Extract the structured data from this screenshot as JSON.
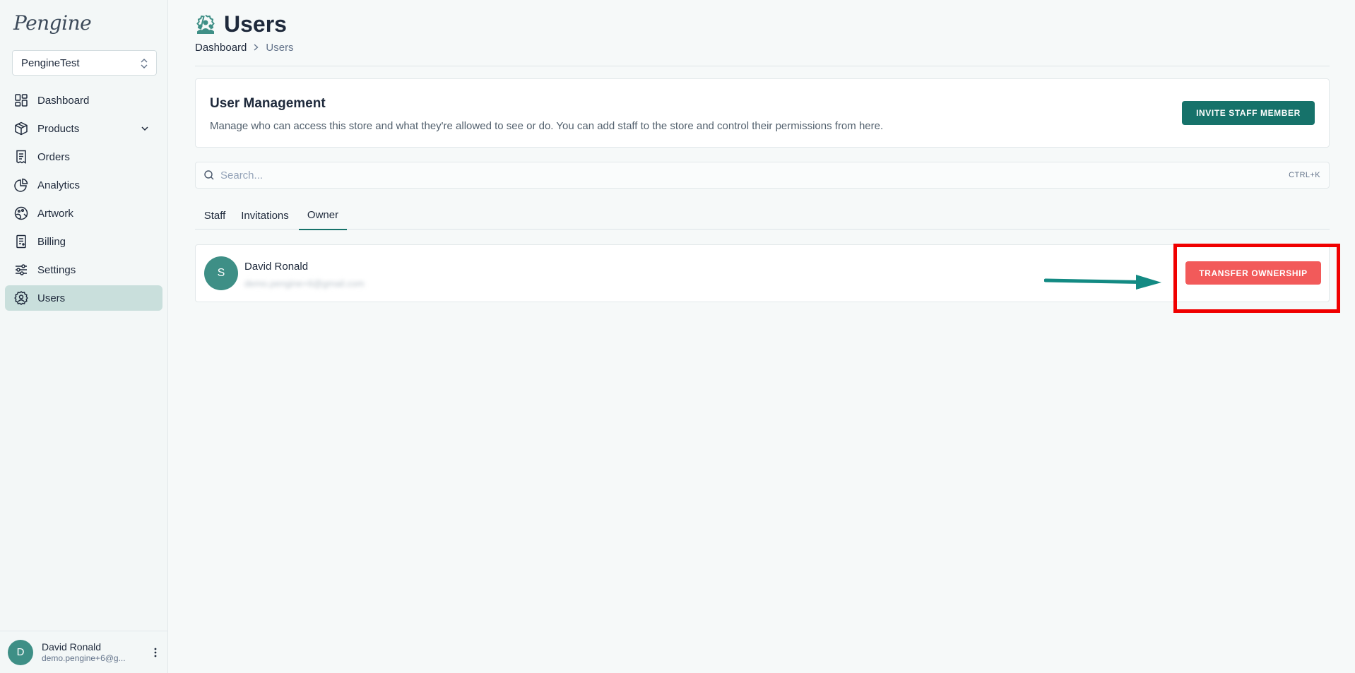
{
  "sidebar": {
    "logo": "Pengine",
    "store_selector": "PengineTest",
    "items": [
      {
        "label": "Dashboard",
        "icon": "grid-icon"
      },
      {
        "label": "Products",
        "icon": "box-icon"
      },
      {
        "label": "Orders",
        "icon": "receipt-icon"
      },
      {
        "label": "Analytics",
        "icon": "pie-chart-icon"
      },
      {
        "label": "Artwork",
        "icon": "palette-icon"
      },
      {
        "label": "Billing",
        "icon": "invoice-icon"
      },
      {
        "label": "Settings",
        "icon": "sliders-icon"
      },
      {
        "label": "Users",
        "icon": "users-gear-icon"
      }
    ],
    "active_item": "Users",
    "user": {
      "avatar_letter": "D",
      "name": "David Ronald",
      "email": "demo.pengine+6@g..."
    }
  },
  "header": {
    "title": "Users",
    "breadcrumb": [
      "Dashboard",
      "Users"
    ]
  },
  "user_management": {
    "title": "User Management",
    "description": "Manage who can access this store and what they're allowed to see or do. You can add staff to the store and control their permissions from here.",
    "invite_button": "INVITE STAFF MEMBER"
  },
  "search": {
    "placeholder": "Search...",
    "shortcut": "CTRL+K"
  },
  "tabs": [
    "Staff",
    "Invitations",
    "Owner"
  ],
  "active_tab": "Owner",
  "owner": {
    "avatar_letter": "S",
    "name": "David Ronald",
    "email": "demo.pengine+6@gmail.com",
    "transfer_button": "TRANSFER OWNERSHIP"
  },
  "colors": {
    "brand": "#16726a",
    "active_nav_bg": "#c9dfdc",
    "avatar": "#3e8f86",
    "danger": "#f25a5a",
    "annotation": "#f00000",
    "arrow": "#138a83"
  }
}
